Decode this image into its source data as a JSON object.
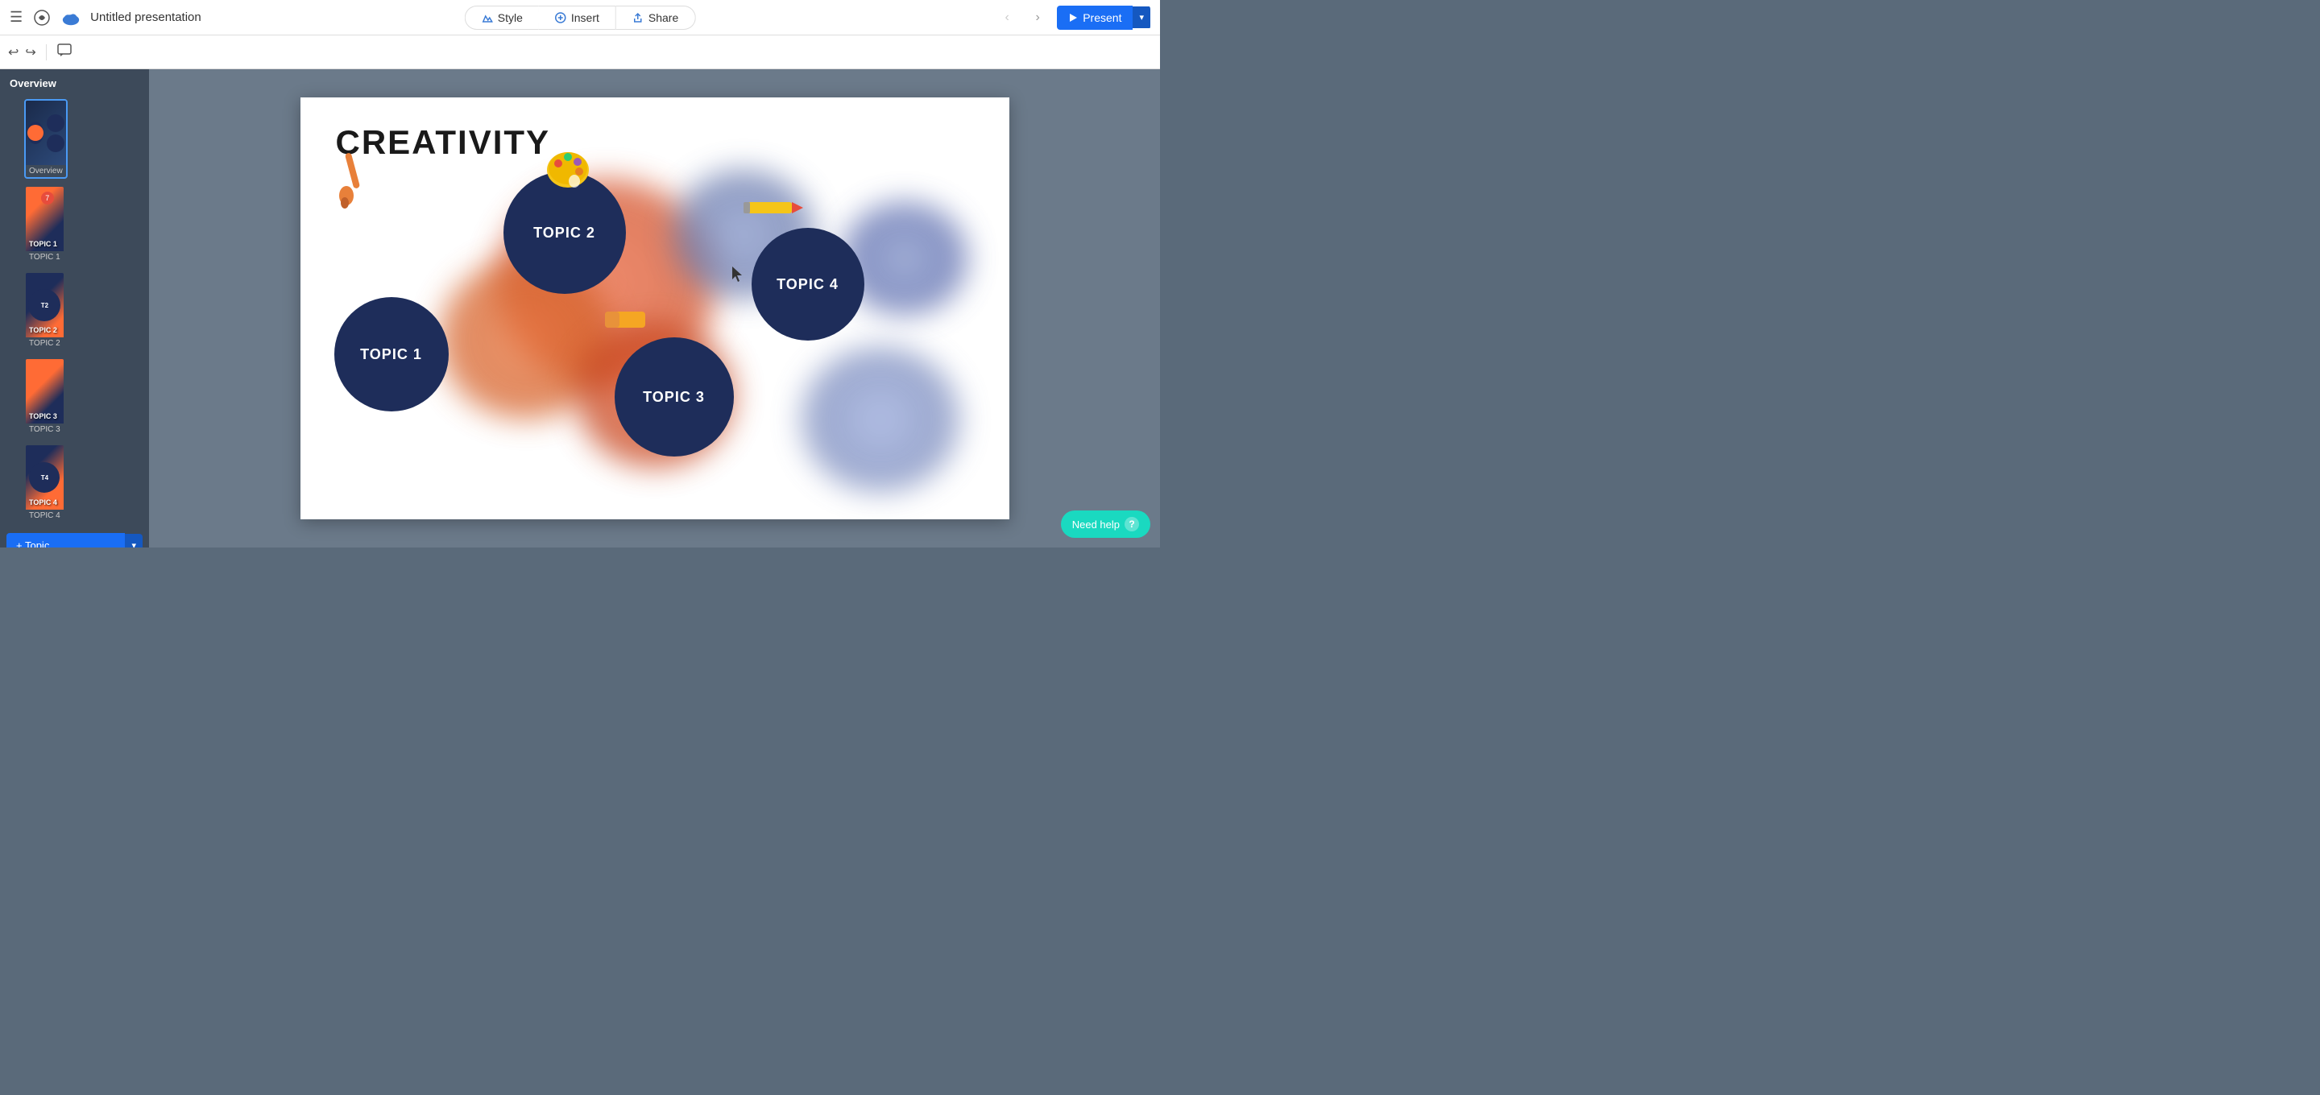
{
  "app": {
    "title": "Untitled presentation",
    "topbar": {
      "style_label": "Style",
      "insert_label": "Insert",
      "share_label": "Share",
      "present_label": "Present"
    }
  },
  "sidebar": {
    "header": "Overview",
    "slides": [
      {
        "id": "overview",
        "label": "Overview",
        "badge": null,
        "active": true
      },
      {
        "id": "1",
        "label": "TOPIC 1",
        "badge": "7",
        "active": false
      },
      {
        "id": "2",
        "label": "TOPIC 2",
        "badge": null,
        "active": false
      },
      {
        "id": "3",
        "label": "TOPIC 3",
        "badge": null,
        "active": false
      },
      {
        "id": "4",
        "label": "TOPIC 4",
        "badge": null,
        "active": false
      }
    ],
    "add_topic_label": "+ Topic"
  },
  "slide": {
    "title": "CREATIVITY",
    "topics": [
      {
        "id": "topic1",
        "label": "TOPIC 1"
      },
      {
        "id": "topic2",
        "label": "TOPIC 2"
      },
      {
        "id": "topic3",
        "label": "TOPIC 3"
      },
      {
        "id": "topic4",
        "label": "TOPIC 4"
      }
    ]
  },
  "help": {
    "label": "Need help",
    "icon": "?"
  }
}
